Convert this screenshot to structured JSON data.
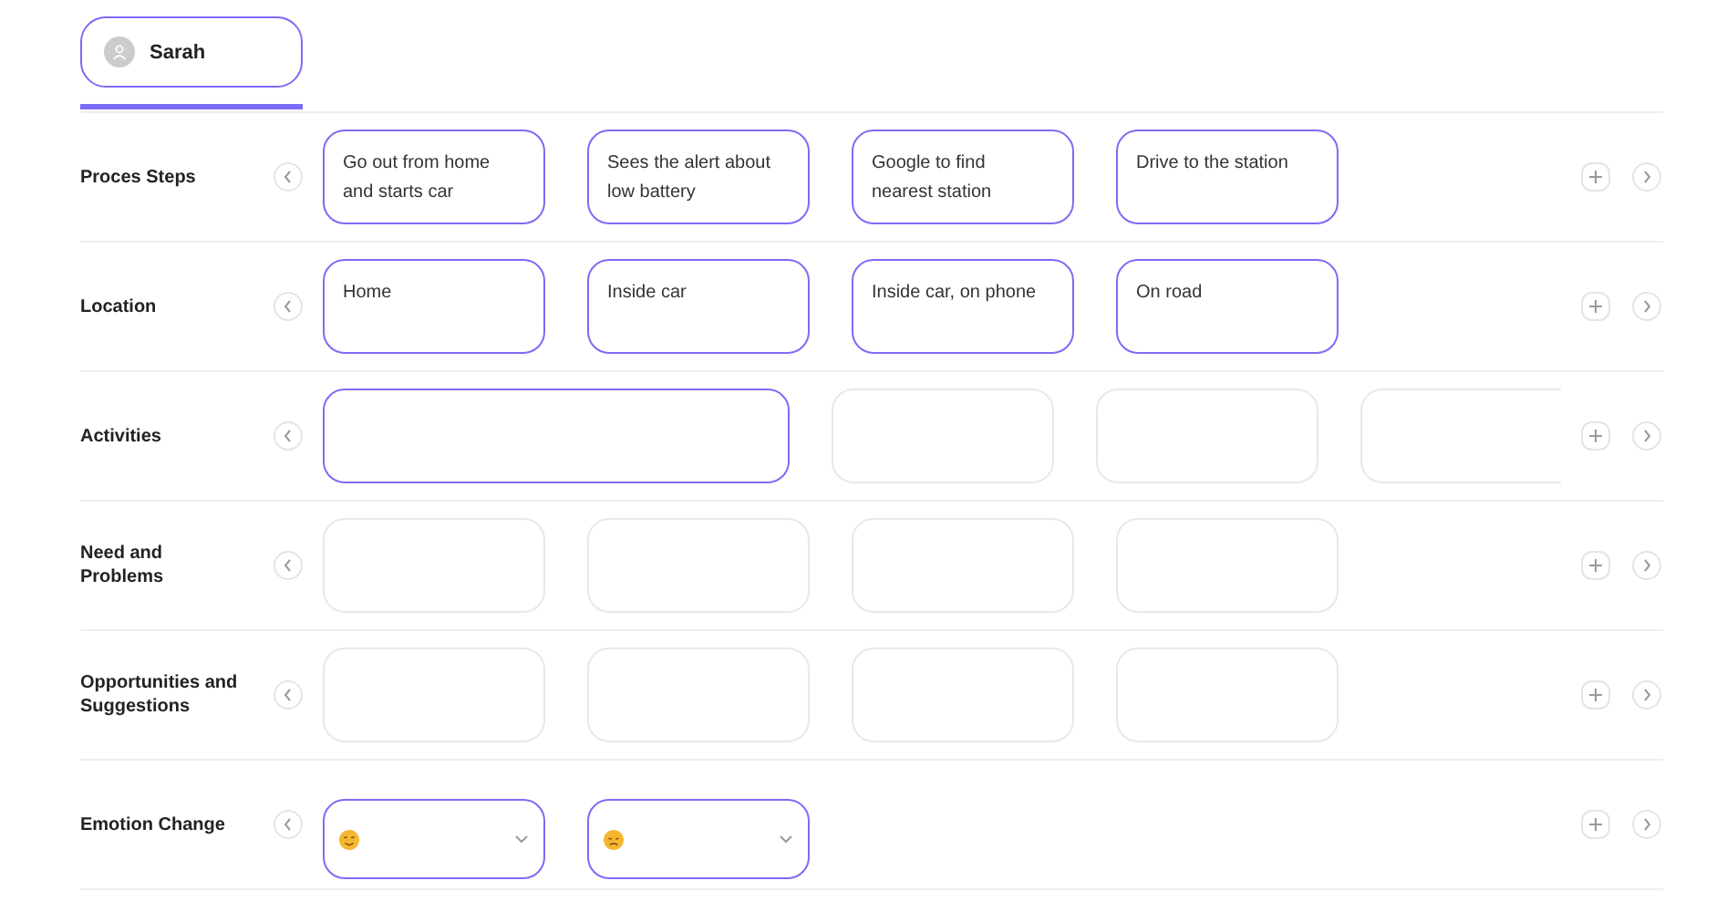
{
  "persona_tab": {
    "name": "Sarah",
    "selected": true
  },
  "rows": [
    {
      "label": "Proces Steps",
      "kind": "cards",
      "cards": [
        {
          "text": "Go out from home and starts car",
          "active": true
        },
        {
          "text": "Sees the alert about low battery",
          "active": true
        },
        {
          "text": "Google to find nearest station",
          "active": true
        },
        {
          "text": "Drive to the station",
          "active": true
        }
      ]
    },
    {
      "label": "Location",
      "kind": "cards",
      "cards": [
        {
          "text": "Home",
          "active": true
        },
        {
          "text": "Inside car",
          "active": true
        },
        {
          "text": "Inside car, on phone",
          "active": true
        },
        {
          "text": "On road",
          "active": true
        }
      ]
    },
    {
      "label": "Activities",
      "kind": "cards",
      "cards": [
        {
          "active": true,
          "wide": true
        },
        {
          "active": false
        },
        {
          "active": false
        },
        {
          "active": false
        }
      ]
    },
    {
      "label": "Need and\nProblems",
      "kind": "cards",
      "cards": [
        {
          "active": false
        },
        {
          "active": false
        },
        {
          "active": false
        },
        {
          "active": false
        }
      ]
    },
    {
      "label": "Opportunities and Suggestions",
      "kind": "cards",
      "cards": [
        {
          "active": false
        },
        {
          "active": false
        },
        {
          "active": false
        },
        {
          "active": false
        }
      ]
    },
    {
      "label": "Emotion Change",
      "kind": "emotions",
      "emotions": [
        {
          "kind": "happy"
        },
        {
          "kind": "sad"
        }
      ]
    }
  ]
}
